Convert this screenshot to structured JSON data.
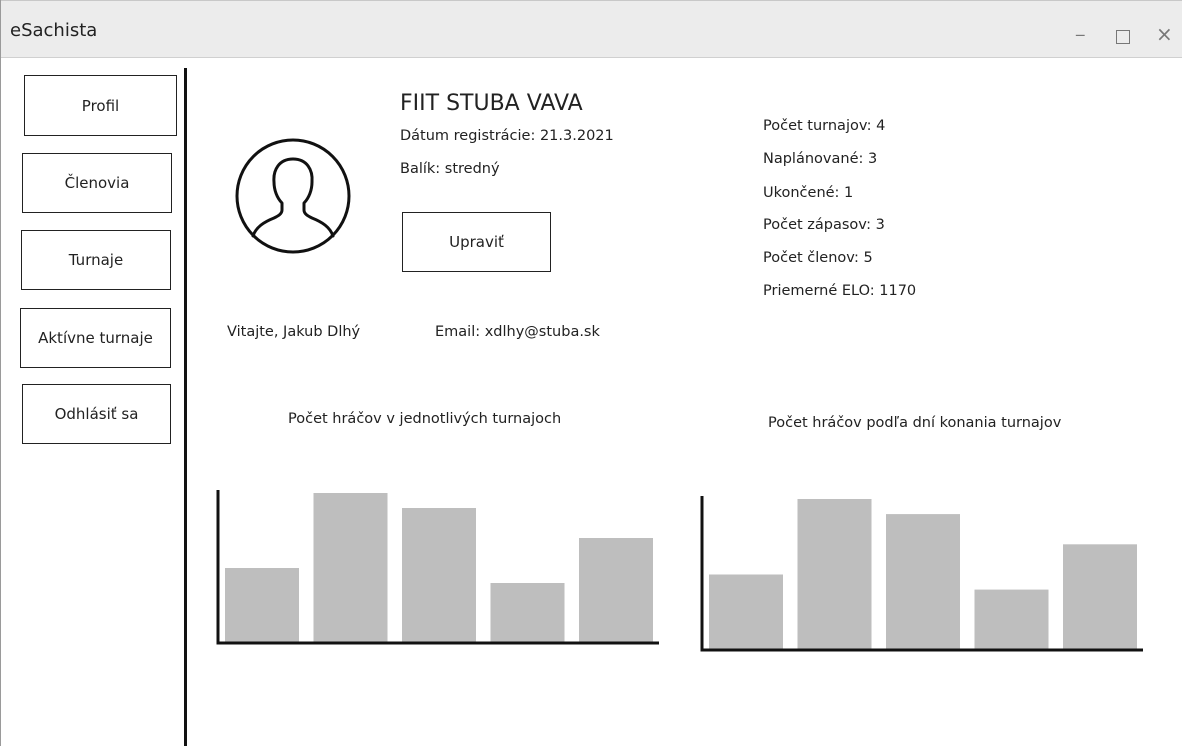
{
  "window": {
    "title": "eSachista",
    "controls": {
      "minimize": "_",
      "close": "×"
    }
  },
  "sidebar": {
    "items": [
      {
        "label": "Profil"
      },
      {
        "label": "Členovia"
      },
      {
        "label": "Turnaje"
      },
      {
        "label": "Aktívne turnaje"
      },
      {
        "label": "Odhlásiť sa"
      }
    ]
  },
  "profile": {
    "org_name": "FIIT STUBA VAVA",
    "registration": "Dátum registrácie: 21.3.2021",
    "package": "Balík: stredný",
    "edit_label": "Upraviť",
    "welcome": "Vitajte, Jakub Dlhý",
    "email": "Email: xdlhy@stuba.sk"
  },
  "stats": [
    "Počet turnajov: 4",
    "Naplánované: 3",
    "Ukončené: 1",
    "Počet zápasov:  3",
    "Počet členov: 5",
    "Priemerné ELO: 1170"
  ],
  "colors": {
    "bar": "#bebebe",
    "axis": "#111111"
  },
  "chart_data": [
    {
      "type": "bar",
      "title": "Počet hráčov v jednotlivých turnajoch",
      "categories": [
        "",
        "",
        "",
        "",
        ""
      ],
      "values": [
        50,
        100,
        90,
        40,
        70
      ],
      "ylim": [
        0,
        100
      ],
      "xlabel": "",
      "ylabel": ""
    },
    {
      "type": "bar",
      "title": "Počet hráčov podľa dní konania turnajov",
      "categories": [
        "",
        "",
        "",
        "",
        ""
      ],
      "values": [
        50,
        100,
        90,
        40,
        70
      ],
      "ylim": [
        0,
        100
      ],
      "xlabel": "",
      "ylabel": ""
    }
  ]
}
